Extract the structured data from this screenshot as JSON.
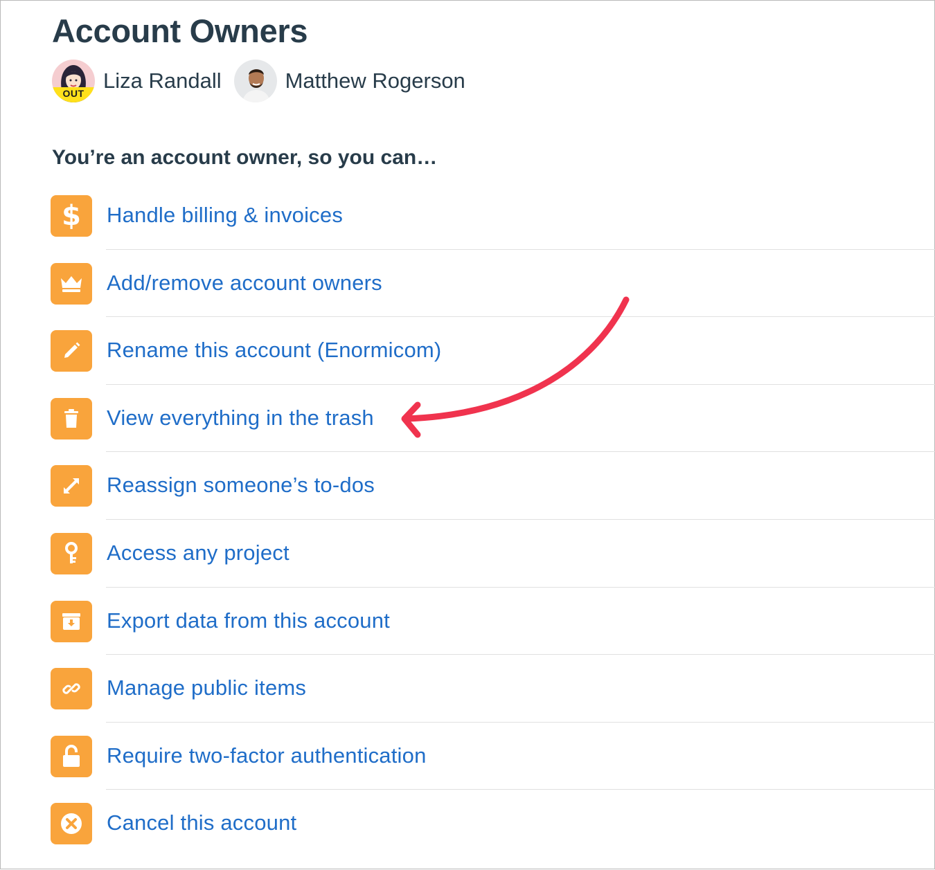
{
  "header": {
    "title": "Account Owners"
  },
  "owners": [
    {
      "name": "Liza Randall",
      "badge": "OUT"
    },
    {
      "name": "Matthew Rogerson"
    }
  ],
  "subheading": "You’re an account owner, so you can…",
  "actions": [
    {
      "label": "Handle billing & invoices",
      "icon": "dollar-icon"
    },
    {
      "label": "Add/remove account owners",
      "icon": "crown-icon"
    },
    {
      "label": "Rename this account (Enormicom)",
      "icon": "pencil-icon"
    },
    {
      "label": "View everything in the trash",
      "icon": "trash-icon"
    },
    {
      "label": "Reassign someone’s to-dos",
      "icon": "reassign-icon"
    },
    {
      "label": "Access any project",
      "icon": "key-icon"
    },
    {
      "label": "Export data from this account",
      "icon": "export-box-icon"
    },
    {
      "label": "Manage public items",
      "icon": "link-icon"
    },
    {
      "label": "Require two-factor authentication",
      "icon": "unlock-icon"
    },
    {
      "label": "Cancel this account",
      "icon": "cancel-circle-icon"
    }
  ],
  "colors": {
    "icon_background": "#f9a43c",
    "link": "#1f6dc8",
    "heading": "#283c4a",
    "out_badge": "#ffe01b",
    "annotation_arrow": "#f0334e"
  }
}
